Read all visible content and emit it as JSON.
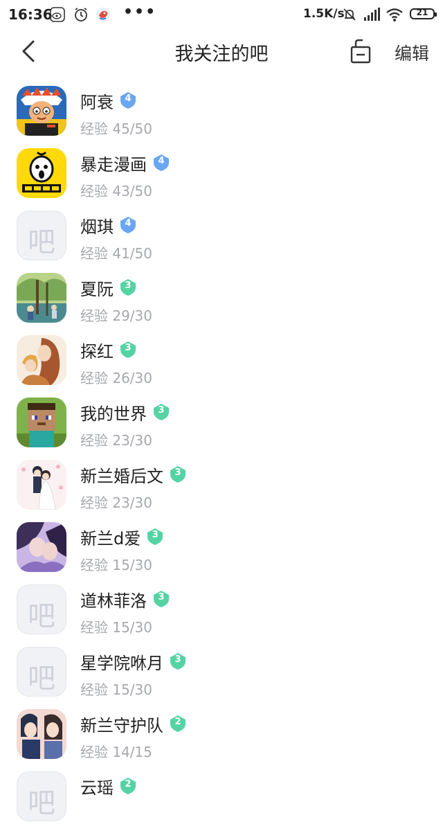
{
  "status_bar": {
    "time": "16:36",
    "net_speed": "1.5K/s",
    "battery": "21",
    "icons": [
      "weibo-icon",
      "alarm-icon",
      "bird-app-icon",
      "more-dots-icon",
      "mute-bell-icon",
      "signal-icon",
      "wifi-icon",
      "battery-icon"
    ]
  },
  "nav": {
    "title": "我关注的吧",
    "edit": "编辑"
  },
  "placeholder_glyph": "吧",
  "colors": {
    "level4": "#6aa7f2",
    "level3": "#56d3a4",
    "level2": "#56d3a4",
    "exp_text": "#a6a8ad"
  },
  "bars": [
    {
      "name": "阿衰",
      "level": "4",
      "exp": "经验 45/50",
      "avatar": "cartoon-boy-image"
    },
    {
      "name": "暴走漫画",
      "level": "4",
      "exp": "经验 43/50",
      "avatar": "baozou-logo-image"
    },
    {
      "name": "烟琪",
      "level": "4",
      "exp": "经验 41/50",
      "avatar": "placeholder"
    },
    {
      "name": "夏阮",
      "level": "3",
      "exp": "经验 29/30",
      "avatar": "forest-illustration-image"
    },
    {
      "name": "探红",
      "level": "3",
      "exp": "经验 26/30",
      "avatar": "couple-illustration-image"
    },
    {
      "name": "我的世界",
      "level": "3",
      "exp": "经验 23/30",
      "avatar": "minecraft-steve-image"
    },
    {
      "name": "新兰婚后文",
      "level": "3",
      "exp": "经验 23/30",
      "avatar": "wedding-illustration-image"
    },
    {
      "name": "新兰d爱",
      "level": "3",
      "exp": "经验 15/30",
      "avatar": "anime-couple-image"
    },
    {
      "name": "道林菲洛",
      "level": "3",
      "exp": "经验 15/30",
      "avatar": "placeholder"
    },
    {
      "name": "星学院咻月",
      "level": "3",
      "exp": "经验 15/30",
      "avatar": "placeholder"
    },
    {
      "name": "新兰守护队",
      "level": "2",
      "exp": "经验 14/15",
      "avatar": "conan-couple-image"
    },
    {
      "name": "云瑶",
      "level": "2",
      "exp": "",
      "avatar": "placeholder"
    }
  ]
}
